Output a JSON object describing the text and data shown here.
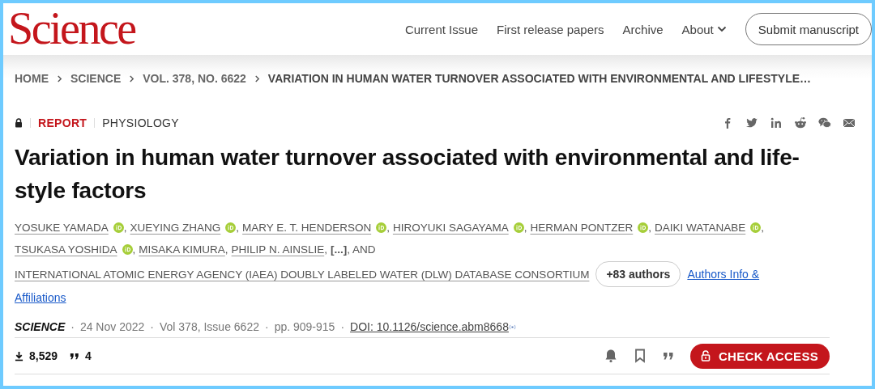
{
  "logo": "Science",
  "nav": [
    {
      "label": "Current Issue",
      "dropdown": false
    },
    {
      "label": "First release papers",
      "dropdown": false
    },
    {
      "label": "Archive",
      "dropdown": false
    },
    {
      "label": "About",
      "dropdown": true
    }
  ],
  "submit_button": "Submit manuscript",
  "breadcrumb": [
    "HOME",
    "SCIENCE",
    "VOL. 378, NO. 6622",
    "VARIATION IN HUMAN WATER TURNOVER ASSOCIATED WITH ENVIRONMENTAL AND LIFESTYLE…"
  ],
  "article": {
    "locked": true,
    "type": "REPORT",
    "subject": "PHYSIOLOGY",
    "title": "Variation in human water turnover associated with environmental and life-style factors",
    "authors": [
      {
        "name": "YOSUKE YAMADA",
        "orcid": true
      },
      {
        "name": "XUEYING ZHANG",
        "orcid": true
      },
      {
        "name": "MARY E. T. HENDERSON",
        "orcid": true
      },
      {
        "name": "HIROYUKI SAGAYAMA",
        "orcid": true
      },
      {
        "name": "HERMAN PONTZER",
        "orcid": true
      },
      {
        "name": "DAIKI WATANABE",
        "orcid": true
      },
      {
        "name": "TSUKASA YOSHIDA",
        "orcid": true
      },
      {
        "name": "MISAKA KIMURA",
        "orcid": false
      },
      {
        "name": "PHILIP N. AINSLIE",
        "orcid": false
      }
    ],
    "author_separator": ",",
    "ellipsis": "[...]",
    "conjunction": ", AND",
    "consortium": "INTERNATIONAL ATOMIC ENERGY AGENCY (IAEA) DOUBLY LABELED WATER (DLW) DATABASE CONSORTIUM",
    "more_authors": "+83 authors",
    "authors_info_link": [
      "Authors Info &",
      "Affiliations"
    ],
    "meta": [
      {
        "kind": "journal",
        "text": "SCIENCE"
      },
      {
        "kind": "plain",
        "text": "24 Nov 2022"
      },
      {
        "kind": "plain",
        "text": "Vol 378, Issue 6622"
      },
      {
        "kind": "plain",
        "text": "pp. 909-915"
      },
      {
        "kind": "doi",
        "text": "DOI: 10.1126/science.abm8668"
      }
    ],
    "meta_separator": "·",
    "downloads": "8,529",
    "citations": "4",
    "access_button": "CHECK ACCESS"
  }
}
